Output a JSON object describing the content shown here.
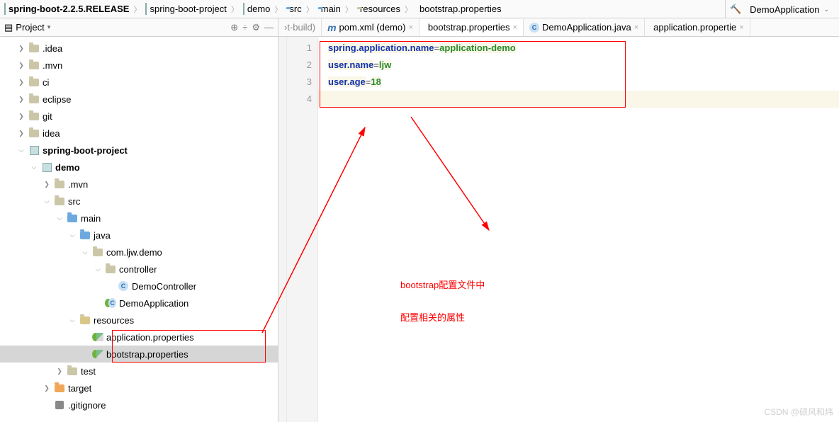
{
  "breadcrumb": [
    {
      "label": "spring-boot-2.2.5.RELEASE",
      "icon": "module",
      "bold": true
    },
    {
      "label": "spring-boot-project",
      "icon": "module"
    },
    {
      "label": "demo",
      "icon": "module"
    },
    {
      "label": "src",
      "icon": "folder-blue"
    },
    {
      "label": "main",
      "icon": "folder-blue"
    },
    {
      "label": "resources",
      "icon": "folder"
    },
    {
      "label": "bootstrap.properties",
      "icon": "prop"
    }
  ],
  "run_config": {
    "label": "DemoApplication"
  },
  "toolbar": {
    "project_label": "Project"
  },
  "tabs": [
    {
      "label": "›t-build)",
      "type": "text",
      "active": false
    },
    {
      "label": "pom.xml (demo)",
      "type": "maven",
      "active": false
    },
    {
      "label": "bootstrap.properties",
      "type": "prop",
      "active": true
    },
    {
      "label": "DemoApplication.java",
      "type": "java",
      "active": false
    },
    {
      "label": "application.propertie",
      "type": "prop",
      "active": false
    }
  ],
  "tree": [
    {
      "d": 1,
      "arrow": ">",
      "icon": "folder",
      "label": ".idea"
    },
    {
      "d": 1,
      "arrow": ">",
      "icon": "folder",
      "label": ".mvn"
    },
    {
      "d": 1,
      "arrow": ">",
      "icon": "folder",
      "label": "ci"
    },
    {
      "d": 1,
      "arrow": ">",
      "icon": "folder",
      "label": "eclipse"
    },
    {
      "d": 1,
      "arrow": ">",
      "icon": "folder",
      "label": "git"
    },
    {
      "d": 1,
      "arrow": ">",
      "icon": "folder",
      "label": "idea"
    },
    {
      "d": 1,
      "arrow": "v",
      "icon": "module",
      "label": "spring-boot-project",
      "bold": true
    },
    {
      "d": 2,
      "arrow": "v",
      "icon": "module",
      "label": "demo",
      "bold": true
    },
    {
      "d": 3,
      "arrow": ">",
      "icon": "folder",
      "label": ".mvn"
    },
    {
      "d": 3,
      "arrow": "v",
      "icon": "folder",
      "label": "src"
    },
    {
      "d": 4,
      "arrow": "v",
      "icon": "folder-blue",
      "label": "main"
    },
    {
      "d": 5,
      "arrow": "v",
      "icon": "folder-blue",
      "label": "java"
    },
    {
      "d": 6,
      "arrow": "v",
      "icon": "folder",
      "label": "com.ljw.demo"
    },
    {
      "d": 7,
      "arrow": "v",
      "icon": "folder",
      "label": "controller"
    },
    {
      "d": 8,
      "arrow": "",
      "icon": "java",
      "label": "DemoController"
    },
    {
      "d": 7,
      "arrow": "",
      "icon": "spring-java",
      "label": "DemoApplication"
    },
    {
      "d": 5,
      "arrow": "v",
      "icon": "folder-res",
      "label": "resources"
    },
    {
      "d": 6,
      "arrow": "",
      "icon": "spring-prop",
      "label": "application.properties"
    },
    {
      "d": 6,
      "arrow": "",
      "icon": "spring-prop",
      "label": "bootstrap.properties",
      "sel": true
    },
    {
      "d": 4,
      "arrow": ">",
      "icon": "folder",
      "label": "test"
    },
    {
      "d": 3,
      "arrow": ">",
      "icon": "folder-orange",
      "label": "target"
    },
    {
      "d": 3,
      "arrow": "",
      "icon": "git",
      "label": ".gitignore"
    }
  ],
  "code_lines": [
    {
      "n": "1",
      "key": "spring.application.name",
      "val": "application-demo"
    },
    {
      "n": "2",
      "key": "user.name",
      "val": "ljw"
    },
    {
      "n": "3",
      "key": "user.age",
      "val": "18"
    },
    {
      "n": "4",
      "key": "",
      "val": ""
    }
  ],
  "annotation": {
    "l1": "bootstrap配置文件中",
    "l2": "配置相关的属性"
  },
  "watermark": "CSDN @硕风和炜"
}
